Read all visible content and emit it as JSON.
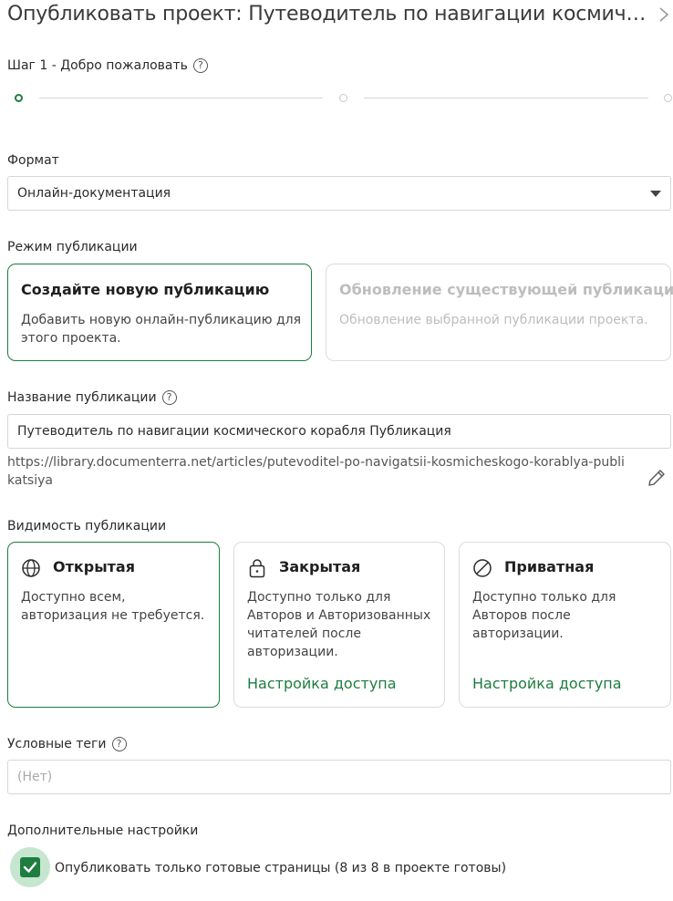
{
  "header": {
    "title": "Опубликовать проект: Путеводитель по навигации космического корабля",
    "chevron_icon": "chevron-right-icon"
  },
  "stepper": {
    "label": "Шаг 1 - Добро пожаловать",
    "help_icon": "?",
    "steps": 3,
    "active_step": 1,
    "active_color": "#1e7d3f"
  },
  "format": {
    "label": "Формат",
    "selected": "Онлайн-документация"
  },
  "publish_mode": {
    "label": "Режим публикации",
    "options": [
      {
        "title": "Создайте новую публикацию",
        "description": "Добавить новую онлайн-публикацию для этого проекта."
      },
      {
        "title": "Обновление существующей публикации",
        "description": "Обновление выбранной публикации проекта."
      }
    ]
  },
  "publication_name": {
    "label": "Название публикации",
    "help_icon": "?",
    "value": "Путеводитель по навигации космического корабля Публикация",
    "url": "https://library.documenterra.net/articles/putevoditel-po-navigatsii-kosmicheskogo-korablya-publikatsiya"
  },
  "visibility": {
    "label": "Видимость публикации",
    "options": [
      {
        "icon": "globe-icon",
        "title": "Открытая",
        "description": "Доступно всем, авторизация не требуется.",
        "link": ""
      },
      {
        "icon": "lock-icon",
        "title": "Закрытая",
        "description": "Доступно только для Авторов и Авторизованных читателей после авторизации.",
        "link": "Настройка доступа"
      },
      {
        "icon": "no-entry-icon",
        "title": "Приватная",
        "description": "Доступно только для Авторов после авторизации.",
        "link": "Настройка доступа"
      }
    ]
  },
  "conditional_tags": {
    "label": "Условные теги",
    "help_icon": "?",
    "placeholder": "(Нет)"
  },
  "additional": {
    "label": "Дополнительные настройки",
    "checkbox_label": "Опубликовать только готовые страницы (8 из 8 в проекте готовы)",
    "checked": true
  },
  "colors": {
    "accent": "#1e7d3f"
  }
}
